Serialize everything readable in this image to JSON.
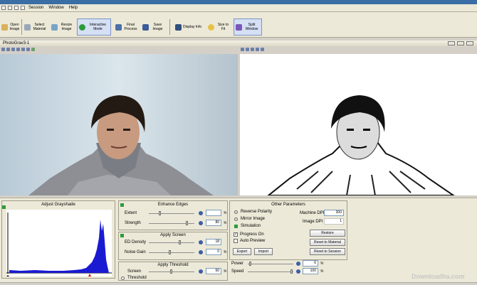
{
  "menu": [
    "Session",
    "Window",
    "Help"
  ],
  "toolbar": {
    "buttons": [
      {
        "label": "Open Image",
        "icon": "open-image-icon"
      },
      {
        "label": "Select Material",
        "icon": "select-material-icon"
      },
      {
        "label": "Resize Image",
        "icon": "resize-image-icon"
      },
      {
        "label": "Interactive Mode",
        "icon": "interactive-mode-icon"
      },
      {
        "label": "Final Process",
        "icon": "final-process-icon"
      },
      {
        "label": "Save Image",
        "icon": "save-image-icon"
      },
      {
        "label": "Display Info",
        "icon": "display-info-icon"
      },
      {
        "label": "Size to Fit",
        "icon": "size-to-fit-icon"
      },
      {
        "label": "Split Window",
        "icon": "split-window-icon"
      }
    ]
  },
  "document": {
    "title": "PhotoGrav3-1"
  },
  "histogram": {
    "title": "Adjust Grayshade"
  },
  "enhance_edges": {
    "title": "Enhance Edges",
    "extent_label": "Extent",
    "extent_value": "",
    "strength_label": "Strength",
    "strength_value": "80",
    "unit": "%"
  },
  "apply_screen": {
    "title": "Apply Screen",
    "ed_density_label": "ED Density",
    "ed_density_value": "18",
    "noise_gain_label": "Noise Gain",
    "noise_gain_value": "0",
    "unit": "%"
  },
  "apply_threshold": {
    "title": "Apply Threshold",
    "screen_label": "Screen",
    "screen_value": "50",
    "threshold_label": "Threshold",
    "unit": "%"
  },
  "other_parameters": {
    "title": "Other Parameters",
    "reverse_polarity": "Reverse Polarity",
    "mirror_image": "Mirror Image",
    "simulation": "Simulation",
    "progress_on": "Progress On",
    "auto_preview": "Auto Preview",
    "machine_dpi_label": "Machine DPI",
    "machine_dpi_value": "300",
    "image_dpi_label": "Image DPI",
    "image_dpi_value": "1",
    "restore_label": "Restore",
    "reset_material_label": "Reset to Material",
    "reset_session_label": "Reset to Session",
    "export_label": "Export",
    "import_label": "Import"
  },
  "power_speed": {
    "power_label": "Power",
    "power_value": "6",
    "speed_label": "Speed",
    "speed_value": "100",
    "unit": "%"
  },
  "watermark": "Downloadha.com"
}
